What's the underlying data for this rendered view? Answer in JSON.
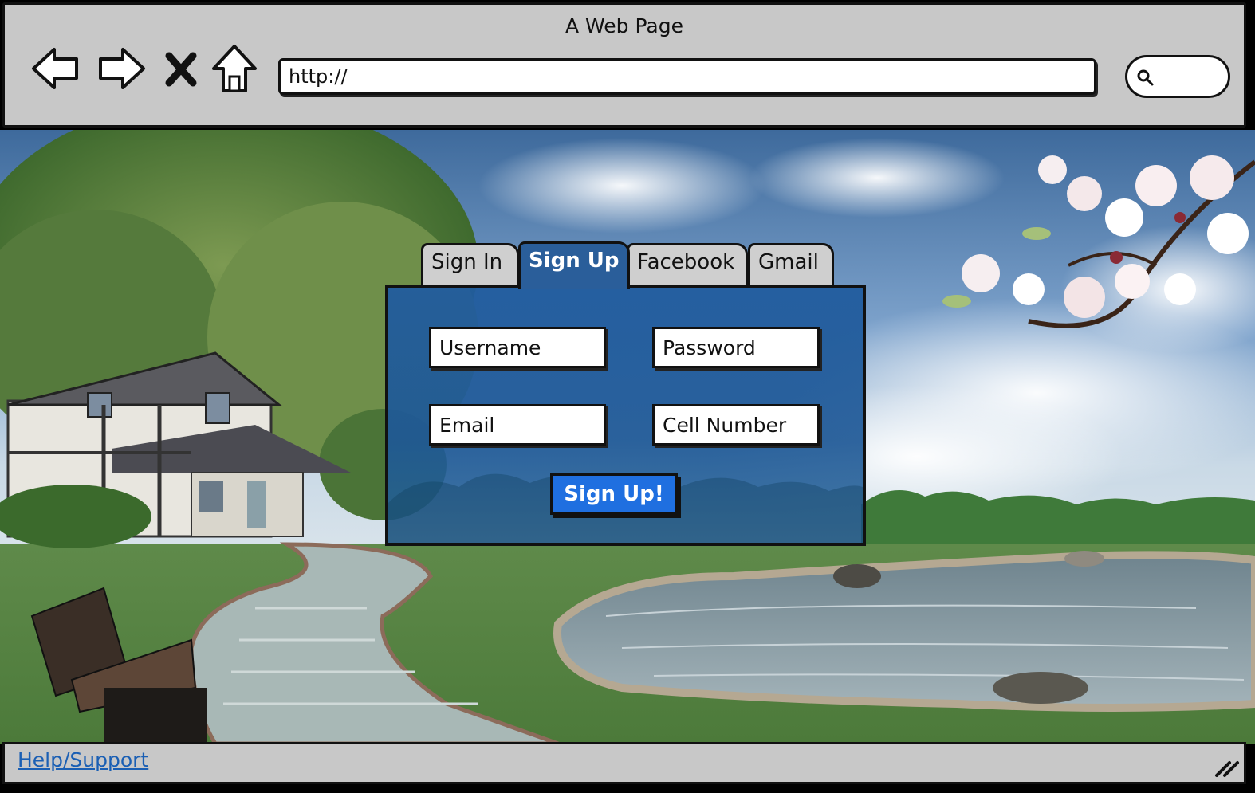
{
  "window": {
    "title": "A Web Page"
  },
  "toolbar": {
    "back_icon": "arrow-left-icon",
    "forward_icon": "arrow-right-icon",
    "stop_icon": "close-icon",
    "home_icon": "home-icon",
    "url": "http://",
    "search_icon": "search-icon",
    "search_value": ""
  },
  "form": {
    "tabs": [
      {
        "label": "Sign In",
        "active": false
      },
      {
        "label": "Sign Up",
        "active": true
      },
      {
        "label": "Facebook",
        "active": false
      },
      {
        "label": "Gmail",
        "active": false
      }
    ],
    "fields": {
      "username": "Username",
      "password": "Password",
      "email": "Email",
      "cell_number": "Cell Number"
    },
    "submit_label": "Sign Up!",
    "accent_color": "#1f6fe0",
    "panel_color": "#2a5e9a"
  },
  "statusbar": {
    "help_link": "Help/Support",
    "resize_icon": "resize-grip-icon"
  },
  "background": {
    "description_colors": {
      "sky": "#7ea3cc",
      "grass": "#5e8a4a",
      "water": "#8fa3ad"
    }
  }
}
